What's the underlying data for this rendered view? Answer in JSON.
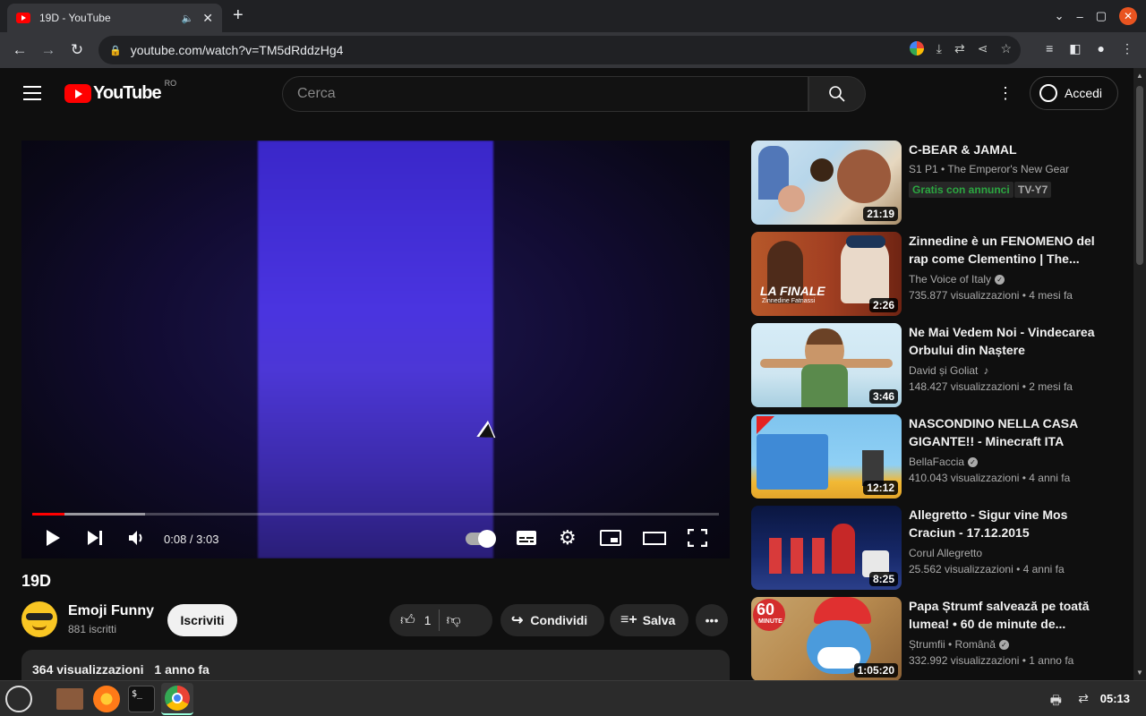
{
  "browser": {
    "tab_title": "19D - YouTube",
    "url": "youtube.com/watch?v=TM5dRddzHg4"
  },
  "youtube": {
    "logo_text": "YouTube",
    "country_code": "RO",
    "search_placeholder": "Cerca",
    "signin_label": "Accedi"
  },
  "player": {
    "current_time": "0:08",
    "duration": "3:03",
    "time_display": "0:08 / 3:03",
    "played_fraction": 0.047,
    "buffered_fraction": 0.164
  },
  "video": {
    "title": "19D",
    "channel": "Emoji Funny",
    "subscribers": "881 iscritti",
    "subscribe_label": "Iscriviti",
    "likes": "1",
    "share_label": "Condividi",
    "save_label": "Salva",
    "views": "364 visualizzazioni",
    "age": "1 anno fa"
  },
  "related": [
    {
      "title": "C-BEAR & JAMAL",
      "channel": "S1 P1 • The Emperor's New Gear",
      "badge_free": "Gratis con annunci",
      "badge_rating": "TV-Y7",
      "duration": "21:19"
    },
    {
      "title": "Zinnedine è un FENOMENO del rap come Clementino | The...",
      "channel": "The Voice of Italy",
      "meta": "735.877 visualizzazioni • 4 mesi fa",
      "duration": "2:26",
      "thumb_text": "LA FINALE",
      "thumb_subtext": "Zinnedine Fatnassi"
    },
    {
      "title": "Ne Mai Vedem Noi - Vindecarea Orbului din Naștere",
      "channel": "David și Goliat",
      "meta": "148.427 visualizzazioni • 2 mesi fa",
      "duration": "3:46"
    },
    {
      "title": "NASCONDINO NELLA CASA GIGANTE!! - Minecraft ITA",
      "channel": "BellaFaccia",
      "meta": "410.043 visualizzazioni • 4 anni fa",
      "duration": "12:12"
    },
    {
      "title": "Allegretto - Sigur vine Mos Craciun - 17.12.2015",
      "channel": "Corul Allegretto",
      "meta": "25.562 visualizzazioni • 4 anni fa",
      "duration": "8:25"
    },
    {
      "title": "Papa Ștrumf salvează pe toată lumea! • 60 de minute de...",
      "channel": "Ștrumfii • Română",
      "meta": "332.992 visualizzazioni • 1 anno fa",
      "duration": "1:05:20",
      "thumb_text": "60",
      "thumb_subtext": "MINUTE"
    }
  ],
  "taskbar": {
    "time": "05:13"
  }
}
